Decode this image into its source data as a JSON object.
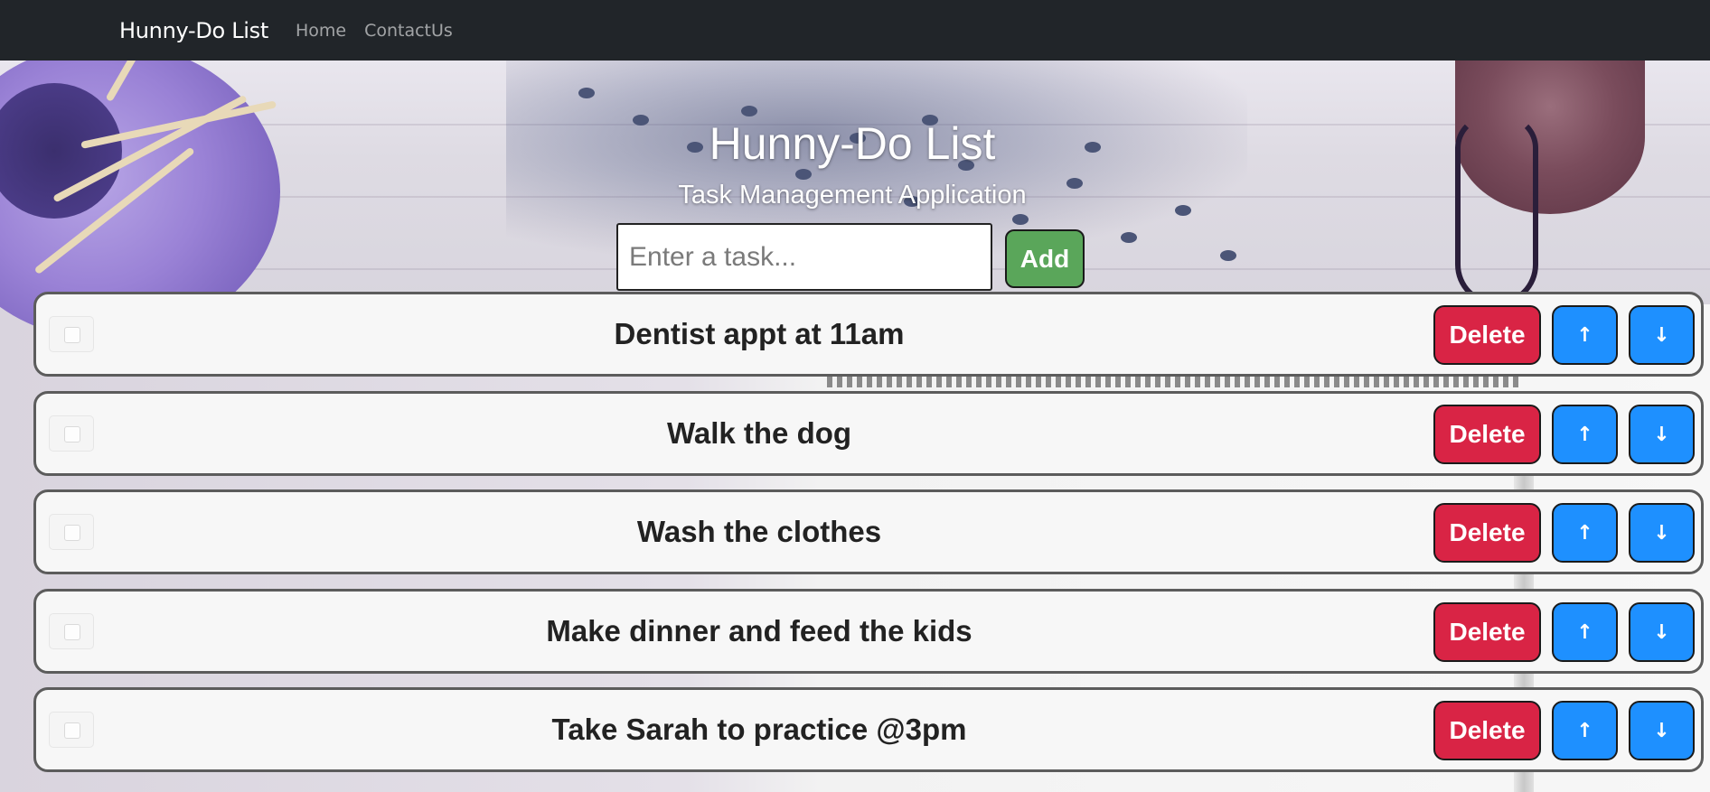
{
  "navbar": {
    "brand": "Hunny-Do List",
    "links": [
      "Home",
      "ContactUs"
    ]
  },
  "header": {
    "title": "Hunny-Do List",
    "subtitle": "Task Management Application"
  },
  "task_form": {
    "placeholder": "Enter a task...",
    "value": "",
    "add_label": "Add"
  },
  "tasks": [
    {
      "text": "Dentist appt at 11am",
      "checked": false
    },
    {
      "text": "Walk the dog",
      "checked": false
    },
    {
      "text": "Wash the clothes",
      "checked": false
    },
    {
      "text": "Make dinner and feed the kids",
      "checked": false
    },
    {
      "text": "Take Sarah to practice @3pm",
      "checked": false
    }
  ],
  "task_actions": {
    "delete_label": "Delete",
    "up_icon": "arrow-up-icon",
    "down_icon": "arrow-down-icon"
  },
  "colors": {
    "navbar": "#212529",
    "add_button": "#5aa65a",
    "delete_button": "#d92445",
    "move_button": "#1e90ff"
  }
}
